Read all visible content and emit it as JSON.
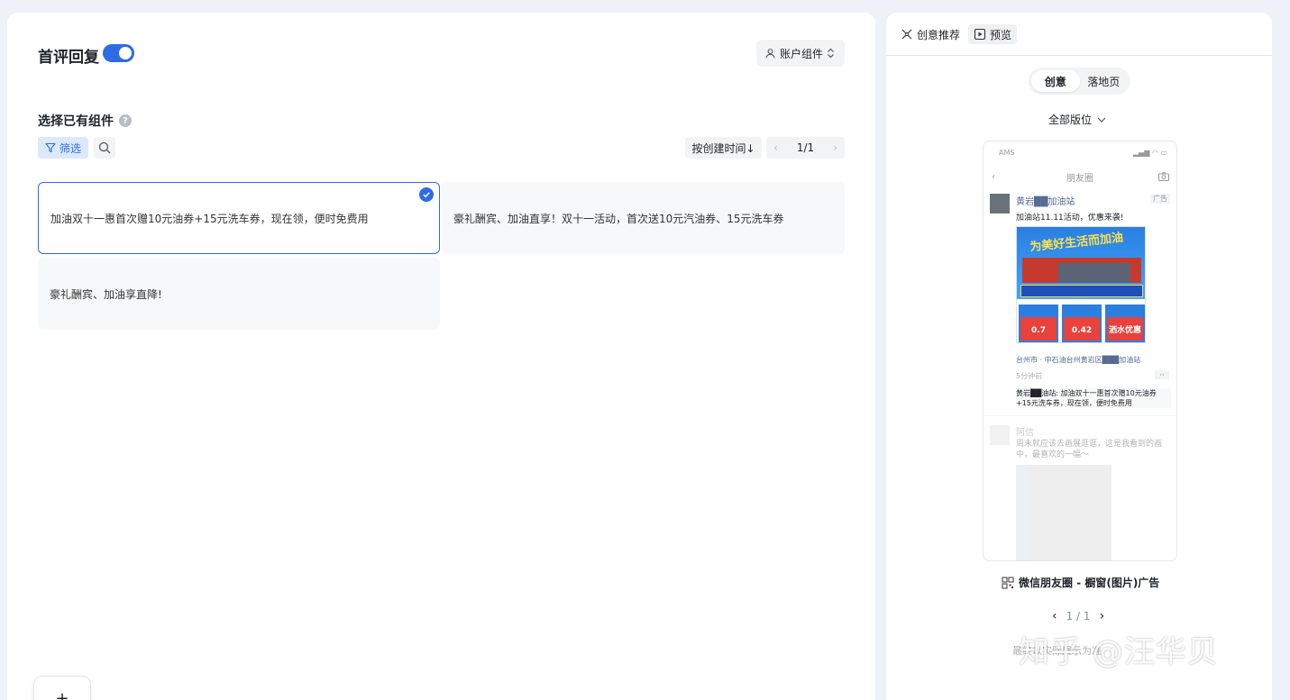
{
  "left": {
    "title": "首评回复",
    "toggle_on": true,
    "account_btn": "账户组件",
    "section_title": "选择已有组件",
    "help": "?",
    "filter_btn": "筛选",
    "sort_btn": "按创建时间↓",
    "pager": {
      "text": "1/1",
      "prev": "‹",
      "next": "›"
    },
    "cards": [
      {
        "text": "加油双十一惠首次赠10元油券+15元洗车券，现在领，便时免费用",
        "selected": true
      },
      {
        "text": "豪礼酬宾、加油直享！双十一活动，首次送10元汽油券、15元洗车券",
        "selected": false
      },
      {
        "text": "豪礼酬宾、加油享直降!",
        "selected": false
      }
    ],
    "add_btn": "+"
  },
  "right": {
    "tab_creative": "创意推荐",
    "tab_preview": "预览",
    "segments": [
      "创意",
      "落地页"
    ],
    "active_segment": 0,
    "all_positions": "全部版位",
    "phone": {
      "status_left": "AMS",
      "nav_title": "朋友圈",
      "post_name": "黄岩██加油站",
      "ad_tag": "广告",
      "post_text": "加油站11.11活动，优惠来袭!",
      "image_headline": "为美好生活而加油",
      "coupons": [
        "0.7",
        "0.42",
        "洒水优惠"
      ],
      "location": "台州市 · 中石油台州黄岩区███加油站",
      "time": "5分钟前",
      "more": "··",
      "comment": "黄岩██油站: 加油双十一惠首次赠10元油券+15元洗车券，现在领，便时免费用",
      "post2_name": "阿信",
      "post2_text": "周末就应该去画展逛逛，这是我看到的画中，最喜欢的一幅～"
    },
    "caption": "微信朋友圈 - 橱窗(图片)广告",
    "pager": {
      "text": "1 / 1",
      "prev": "‹",
      "next": "›"
    },
    "note": "最终以实际展示为准",
    "watermark": "知乎 @汪华贝"
  },
  "colors": {
    "accent": "#2f6be6",
    "filter_bg": "#dbe8fd",
    "link": "#576b95"
  }
}
